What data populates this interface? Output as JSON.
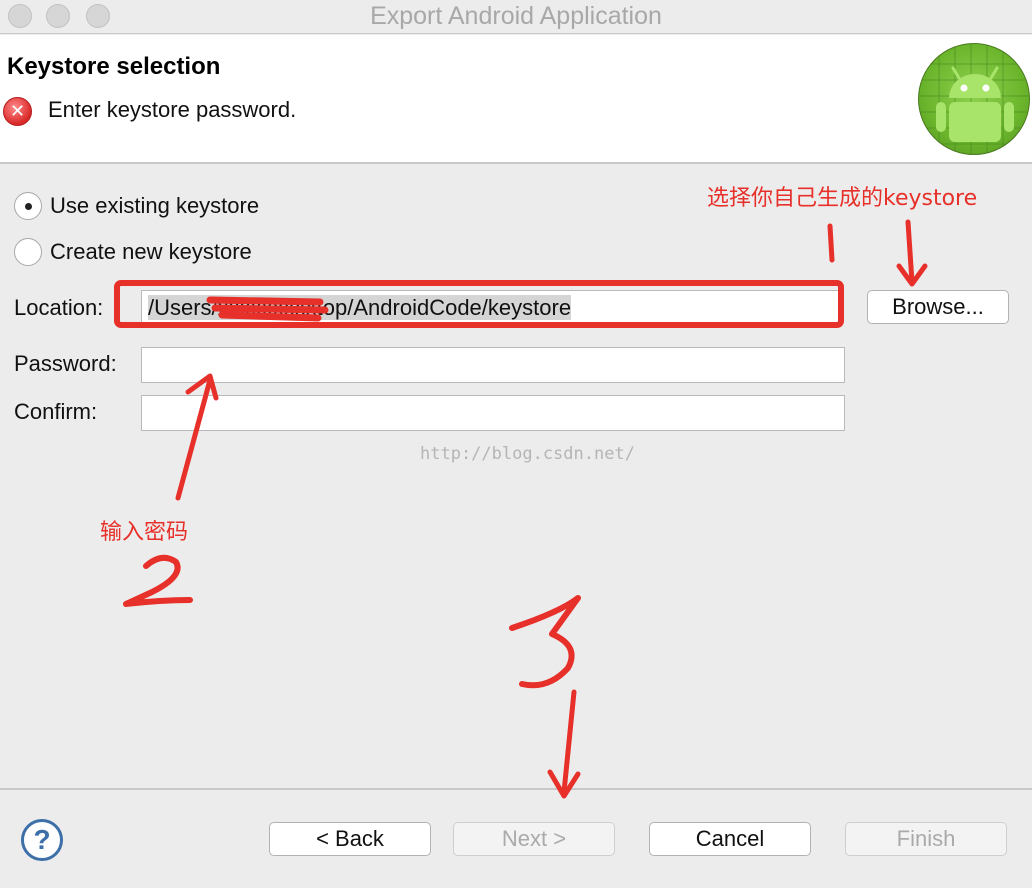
{
  "window": {
    "title": "Export Android Application"
  },
  "header": {
    "title": "Keystore selection",
    "message": "Enter keystore password."
  },
  "options": [
    {
      "label": "Use existing keystore",
      "selected": true
    },
    {
      "label": "Create new keystore",
      "selected": false
    }
  ],
  "form": {
    "location_label": "Location:",
    "location_value": "/Users/xxxxxxxxxtop/AndroidCode/keystore",
    "password_label": "Password:",
    "password_value": "",
    "confirm_label": "Confirm:",
    "confirm_value": "",
    "browse_label": "Browse..."
  },
  "watermark": "http://blog.csdn.net/",
  "annotations": {
    "keystore_hint": "选择你自己生成的keystore",
    "password_hint": "输入密码"
  },
  "footer": {
    "back_label": "< Back",
    "next_label": "Next >",
    "cancel_label": "Cancel",
    "finish_label": "Finish"
  },
  "colors": {
    "annotation": "#e8302a",
    "android_green": "#6bb52c",
    "error_red": "#d92828"
  },
  "icons": [
    "error-icon",
    "android-logo-icon",
    "help-icon"
  ]
}
